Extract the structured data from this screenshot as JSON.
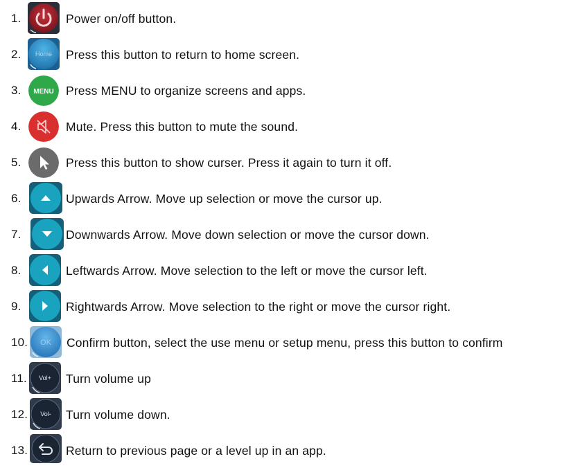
{
  "items": [
    {
      "num": "1.",
      "icon": "power-icon",
      "text": "Power on/off button."
    },
    {
      "num": "2.",
      "icon": "home-icon",
      "icon_label": "Home",
      "text": "Press this button to return to home screen."
    },
    {
      "num": "3.",
      "icon": "menu-icon",
      "icon_label": "MENU",
      "text": "Press MENU to organize screens and apps."
    },
    {
      "num": "4.",
      "icon": "mute-icon",
      "text": "Mute. Press this button to mute the sound."
    },
    {
      "num": "5.",
      "icon": "cursor-icon",
      "text": "Press this button to show curser. Press it again to turn it off."
    },
    {
      "num": "6.",
      "icon": "arrow-up-icon",
      "text": "Upwards Arrow. Move up selection or move the cursor up."
    },
    {
      "num": "7.",
      "icon": "arrow-down-icon",
      "text": "Downwards Arrow. Move down selection or move the cursor down."
    },
    {
      "num": "8.",
      "icon": "arrow-left-icon",
      "text": "Leftwards Arrow. Move selection to the left or move the cursor left."
    },
    {
      "num": "9.",
      "icon": "arrow-right-icon",
      "text": "Rightwards Arrow. Move selection to the right or move the cursor right."
    },
    {
      "num": "10.",
      "icon": "ok-icon",
      "icon_label": "OK",
      "text": "Confirm button, select the use menu or setup menu, press this button to confirm"
    },
    {
      "num": "11.",
      "icon": "volume-up-icon",
      "icon_label": "Vol+",
      "text": "Turn volume up"
    },
    {
      "num": "12.",
      "icon": "volume-down-icon",
      "icon_label": "Vol-",
      "text": "Turn volume down."
    },
    {
      "num": "13.",
      "icon": "back-icon",
      "text": "Return to previous page or a level up in an app."
    }
  ],
  "colors": {
    "power": "#a51f2a",
    "home": "#2e8fc9",
    "menu": "#2fa84a",
    "mute": "#d9302f",
    "cursor": "#6b6b6b",
    "arrow": "#1aa3bf",
    "ok": "#3d8fcf",
    "dark": "#1f2a3a"
  }
}
